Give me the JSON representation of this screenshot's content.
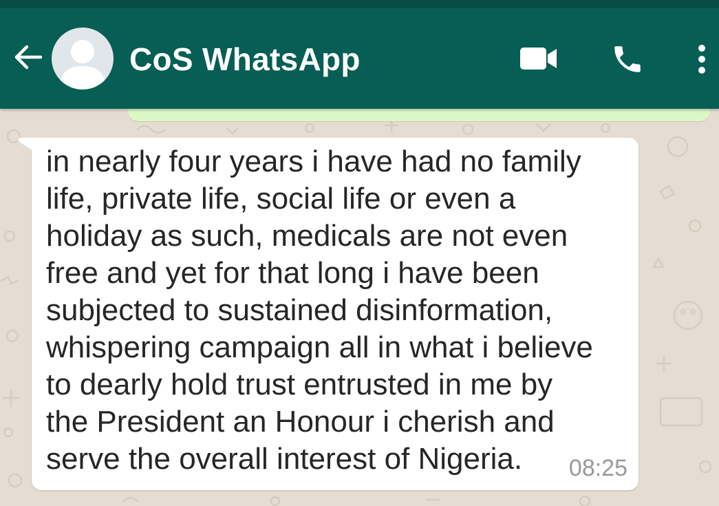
{
  "header": {
    "title": "CoS WhatsApp",
    "background_color": "#075e54",
    "status_strip_color": "#054d44",
    "back_icon": "back-arrow-icon",
    "avatar_icon": "default-contact-avatar-icon",
    "actions": [
      {
        "name": "video-call",
        "icon": "video-camera-icon"
      },
      {
        "name": "voice-call",
        "icon": "phone-icon"
      },
      {
        "name": "more-options",
        "icon": "three-dot-menu-icon"
      }
    ]
  },
  "chat": {
    "wallpaper_color": "#e6ddd2",
    "outgoing_bubble_color": "#dcf8c6",
    "incoming_bubble_color": "#ffffff",
    "messages": [
      {
        "direction": "incoming",
        "text": "in nearly four years i have had no family\nlife, private life, social life or even a\nholiday as such, medicals are not even\nfree and yet for that long i have been\nsubjected to sustained disinformation,\nwhispering campaign all in what i believe\nto dearly hold trust entrusted in me by\nthe President an Honour i cherish and\nserve the overall interest of Nigeria.",
        "time": "08:25"
      }
    ]
  }
}
